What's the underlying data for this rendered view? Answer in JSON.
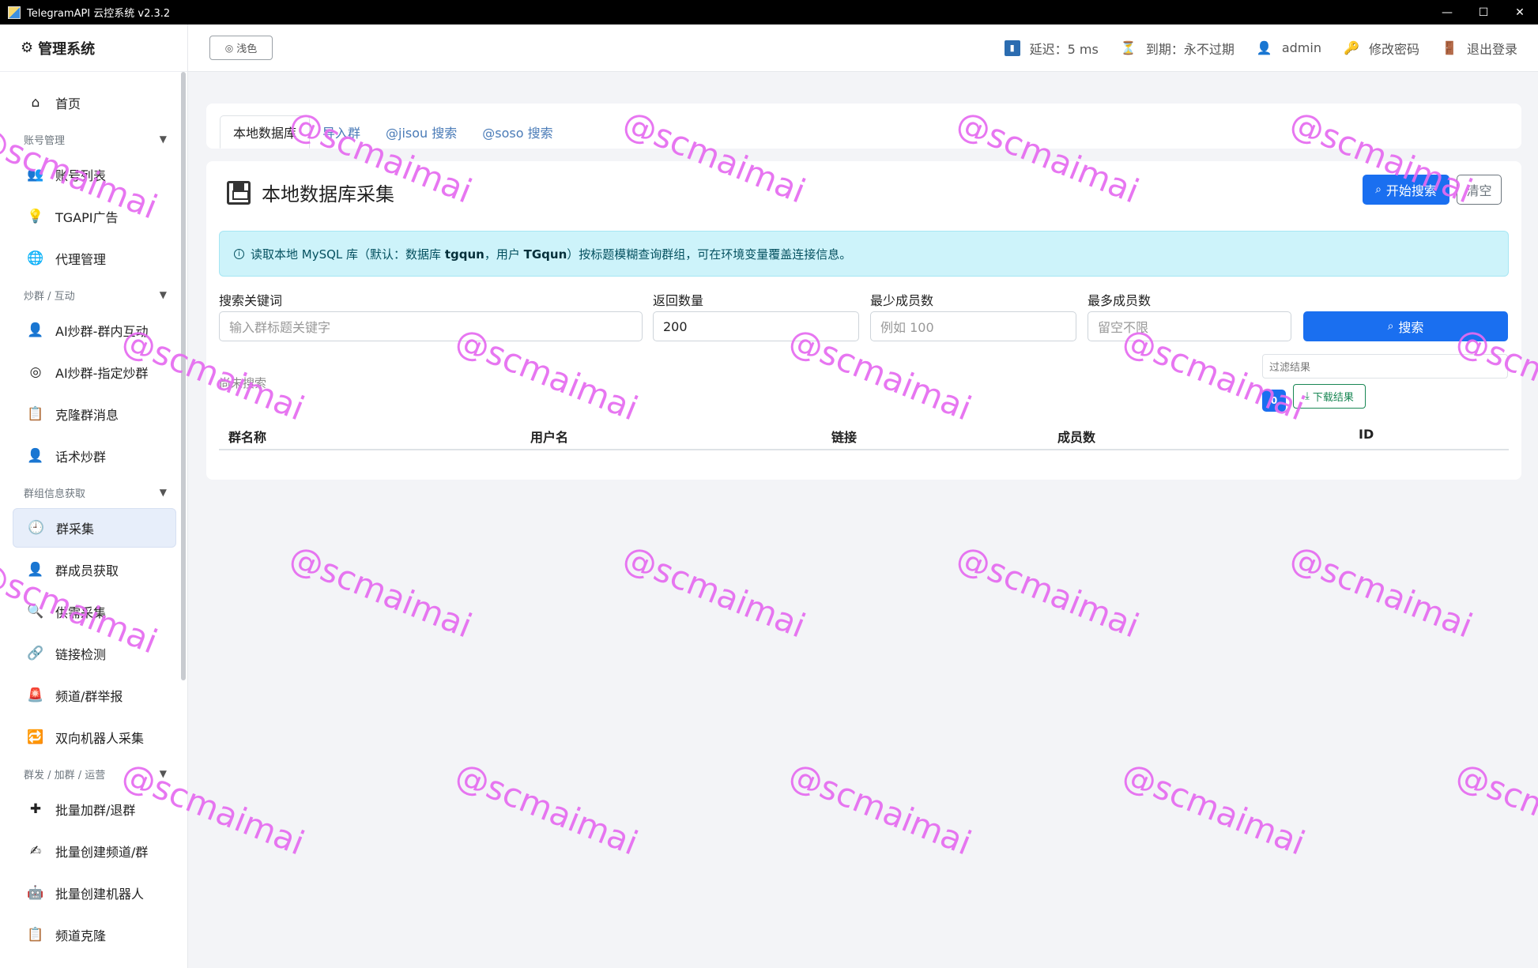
{
  "window": {
    "title": "TelegramAPI 云控系统 v2.3.2",
    "minimize": "—",
    "maximize": "☐",
    "close": "✕"
  },
  "sidebar": {
    "brand": "管理系统",
    "items": [
      {
        "label": "首页",
        "icon": "home-icon"
      },
      {
        "group": "账号管理"
      },
      {
        "label": "账号列表",
        "icon": "users-icon"
      },
      {
        "label": "TGAPI广告",
        "icon": "bulb-icon"
      },
      {
        "label": "代理管理",
        "icon": "globe-icon"
      },
      {
        "group": "炒群 / 互动"
      },
      {
        "label": "AI炒群-群内互动",
        "icon": "user-chat-icon"
      },
      {
        "label": "AI炒群-指定炒群",
        "icon": "target-icon"
      },
      {
        "label": "克隆群消息",
        "icon": "clipboard-icon"
      },
      {
        "label": "话术炒群",
        "icon": "user-script-icon"
      },
      {
        "group": "群组信息获取"
      },
      {
        "label": "群采集",
        "icon": "clock-icon",
        "active": true
      },
      {
        "label": "群成员获取",
        "icon": "member-icon"
      },
      {
        "label": "供需采集",
        "icon": "magnifier-icon"
      },
      {
        "label": "链接检测",
        "icon": "link-icon"
      },
      {
        "label": "频道/群举报",
        "icon": "siren-icon"
      },
      {
        "label": "双向机器人采集",
        "icon": "repeat-icon"
      },
      {
        "group": "群发 / 加群 / 运营"
      },
      {
        "label": "批量加群/退群",
        "icon": "plus-icon"
      },
      {
        "label": "批量创建频道/群",
        "icon": "pen-user-icon"
      },
      {
        "label": "批量创建机器人",
        "icon": "robot-icon"
      },
      {
        "label": "频道克隆",
        "icon": "clipboard-icon"
      }
    ]
  },
  "header": {
    "theme_label": "浅色",
    "latency": "延迟：5 ms",
    "expiry": "到期：永不过期",
    "user": "admin",
    "change_password": "修改密码",
    "logout": "退出登录"
  },
  "tabs": [
    "本地数据库",
    "导入群",
    "@jisou 搜索",
    "@soso 搜索"
  ],
  "card": {
    "title": "本地数据库采集",
    "start_search": "开始搜索",
    "clear": "清空",
    "alert_pre": "读取本地 MySQL 库（默认：数据库 ",
    "alert_db": "tgqun",
    "alert_mid": "，用户 ",
    "alert_user": "TGqun",
    "alert_post": "）按标题模糊查询群组，可在环境变量覆盖连接信息。"
  },
  "form": {
    "keyword_label": "搜索关键词",
    "keyword_placeholder": "输入群标题关键字",
    "count_label": "返回数量",
    "count_value": "200",
    "min_label": "最少成员数",
    "min_placeholder": "例如 100",
    "max_label": "最多成员数",
    "max_placeholder": "留空不限",
    "search_button": "搜索"
  },
  "results": {
    "filter_placeholder": "过滤结果",
    "status": "尚未搜索",
    "count": "0",
    "download": "下载结果",
    "columns": [
      "群名称",
      "用户名",
      "链接",
      "成员数",
      "ID"
    ]
  },
  "watermark": "@scmaimai",
  "colors": {
    "primary": "#1a6ff0",
    "info_bg": "#cdf3fa",
    "success": "#198754",
    "watermark": "#e56bf0"
  }
}
